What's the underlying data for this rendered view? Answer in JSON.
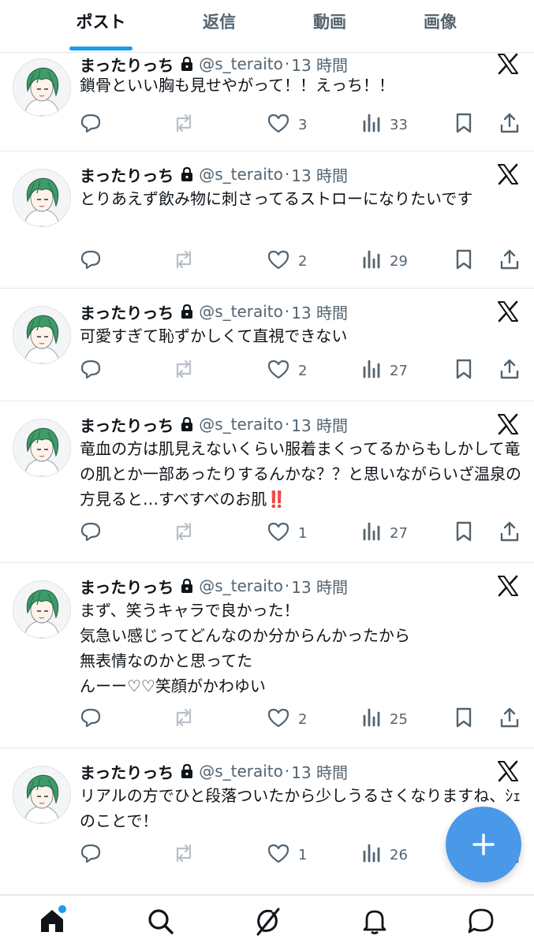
{
  "tabs": [
    "ポスト",
    "返信",
    "動画",
    "画像"
  ],
  "colors": {
    "accent": "#1d9bf0",
    "fab": "#4a99e9",
    "text": "#0f1419",
    "muted": "#536471",
    "error": "#e0245e"
  },
  "posts": [
    {
      "name": "まったりっち",
      "handle": "@s_teraito",
      "separator": "·",
      "time": "13 時間",
      "text": "鎖骨といい胸も見せやがって！！えっち！！",
      "likes": "3",
      "views": "33"
    },
    {
      "name": "まったりっち",
      "handle": "@s_teraito",
      "separator": "·",
      "time": "13 時間",
      "text": "とりあえず飲み物に刺さってるストローになりたいです",
      "likes": "2",
      "views": "29"
    },
    {
      "name": "まったりっち",
      "handle": "@s_teraito",
      "separator": "·",
      "time": "13 時間",
      "text": "可愛すぎて恥ずかしくて直視できない",
      "likes": "2",
      "views": "27"
    },
    {
      "name": "まったりっち",
      "handle": "@s_teraito",
      "separator": "·",
      "time": "13 時間",
      "text": "竜血の方は肌見えないくらい服着まくってるからもしかして竜の肌とか一部あったりするんかな？？と思いながらいざ温泉の方見ると…すべすべのお肌",
      "emoji": "‼️",
      "likes": "1",
      "views": "27"
    },
    {
      "name": "まったりっち",
      "handle": "@s_teraito",
      "separator": "·",
      "time": "13 時間",
      "text": "まず、笑うキャラで良かった！\n気急い感じってどんなのか分からんかったから\n無表情なのかと思ってた\nんーー♡♡笑顔がかわゆい",
      "likes": "2",
      "views": "25"
    },
    {
      "name": "まったりっち",
      "handle": "@s_teraito",
      "separator": "·",
      "time": "13 時間",
      "text": "リアルの方でひと段落ついたから少しうるさくなりますね、ｼｪのことで！",
      "likes": "1",
      "views": "26"
    }
  ],
  "icons": {
    "reply": "reply-icon",
    "retweet": "retweet-icon",
    "like": "heart-icon",
    "views": "views-icon",
    "bookmark": "bookmark-icon",
    "share": "share-icon",
    "compose": "plus-icon",
    "home": "home-icon",
    "search": "search-icon",
    "grok": "grok-icon",
    "notifications": "bell-icon",
    "messages": "message-icon"
  }
}
